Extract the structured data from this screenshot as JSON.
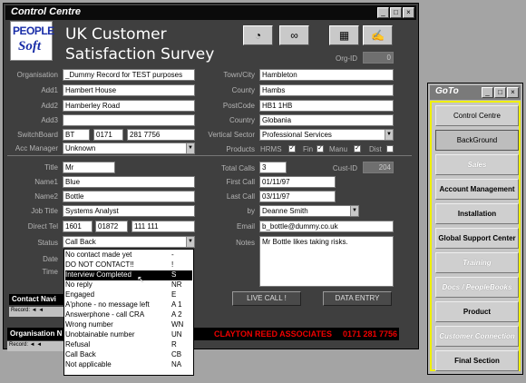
{
  "window": {
    "title": "Control Centre"
  },
  "logo": {
    "line1": "PEOPLE",
    "line2": "Soft"
  },
  "header": {
    "title_line1": "UK Customer",
    "title_line2": "Satisfaction Survey",
    "org_id_label": "Org-ID",
    "org_id": "0"
  },
  "org": {
    "organisation_label": "Organisation",
    "organisation": "_Dummy Record for TEST purposes",
    "add1_label": "Add1",
    "add1": "Hambert House",
    "add2_label": "Add2",
    "add2": "Hamberley Road",
    "add3_label": "Add3",
    "add3": "",
    "switchboard_label": "SwitchBoard",
    "sw1": "BT",
    "sw2": "0171",
    "sw3": "281 7756",
    "acc_manager_label": "Acc Manager",
    "acc_manager": "Unknown",
    "town_label": "Town/City",
    "town": "Hambleton",
    "county_label": "County",
    "county": "Hambs",
    "postcode_label": "PostCode",
    "postcode": "HB1 1HB",
    "country_label": "Country",
    "country": "Globania",
    "vertical_label": "Vertical Sector",
    "vertical": "Professional Services",
    "products_label": "Products",
    "p1": "HRMS",
    "p2": "Fin",
    "p3": "Manu",
    "p4": "Dist"
  },
  "contact": {
    "title_label": "Title",
    "title": "Mr",
    "name1_label": "Name1",
    "name1": "Blue",
    "name2_label": "Name2",
    "name2": "Bottle",
    "job_label": "Job Title",
    "job": "Systems Analyst",
    "tel_label": "Direct Tel",
    "tel1": "1601",
    "tel2": "01872",
    "tel3": "111 111",
    "status_label": "Status",
    "status": "Call Back",
    "date_label": "Date",
    "time_label": "Time",
    "total_calls_label": "Total Calls",
    "total_calls": "3",
    "cust_id_label": "Cust-ID",
    "cust_id": "204",
    "first_call_label": "First Call",
    "first_call": "01/11/97",
    "last_call_label": "Last Call",
    "last_call": "03/11/97",
    "by_label": "by",
    "by": "Deanne Smith",
    "email_label": "Email",
    "email": "b_bottle@dummy.co.uk",
    "notes_label": "Notes",
    "notes": "Mr Bottle likes taking risks."
  },
  "status_options": [
    {
      "label": "No contact made yet",
      "code": "-"
    },
    {
      "label": "DO NOT CONTACT!!",
      "code": "!"
    },
    {
      "label": "Interview Completed",
      "code": "S"
    },
    {
      "label": "No reply",
      "code": "NR"
    },
    {
      "label": "Engaged",
      "code": "E"
    },
    {
      "label": "A'phone - no message left",
      "code": "A 1"
    },
    {
      "label": "Answerphone - call CRA",
      "code": "A 2"
    },
    {
      "label": "Wrong number",
      "code": "WN"
    },
    {
      "label": "Unobtainable number",
      "code": "UN"
    },
    {
      "label": "Refusal",
      "code": "R"
    },
    {
      "label": "Call Back",
      "code": "CB"
    },
    {
      "label": "Not applicable",
      "code": "NA"
    }
  ],
  "buttons": {
    "live_call": "LIVE CALL !",
    "data_entry": "DATA ENTRY"
  },
  "footer": {
    "contact_nav": "Contact Navi",
    "org_nav": "Organisation N",
    "record": "Record:",
    "company": "CLAYTON REED ASSOCIATES",
    "phone": "0171 281 7756"
  },
  "goto": {
    "title": "GoTo",
    "items": [
      "Control Centre",
      "BackGround",
      "Sales",
      "Account Management",
      "Installation",
      "Global Support Center",
      "Training",
      "Docs / PeopleBooks",
      "Product",
      "Customer Connection",
      "Final Section"
    ]
  }
}
